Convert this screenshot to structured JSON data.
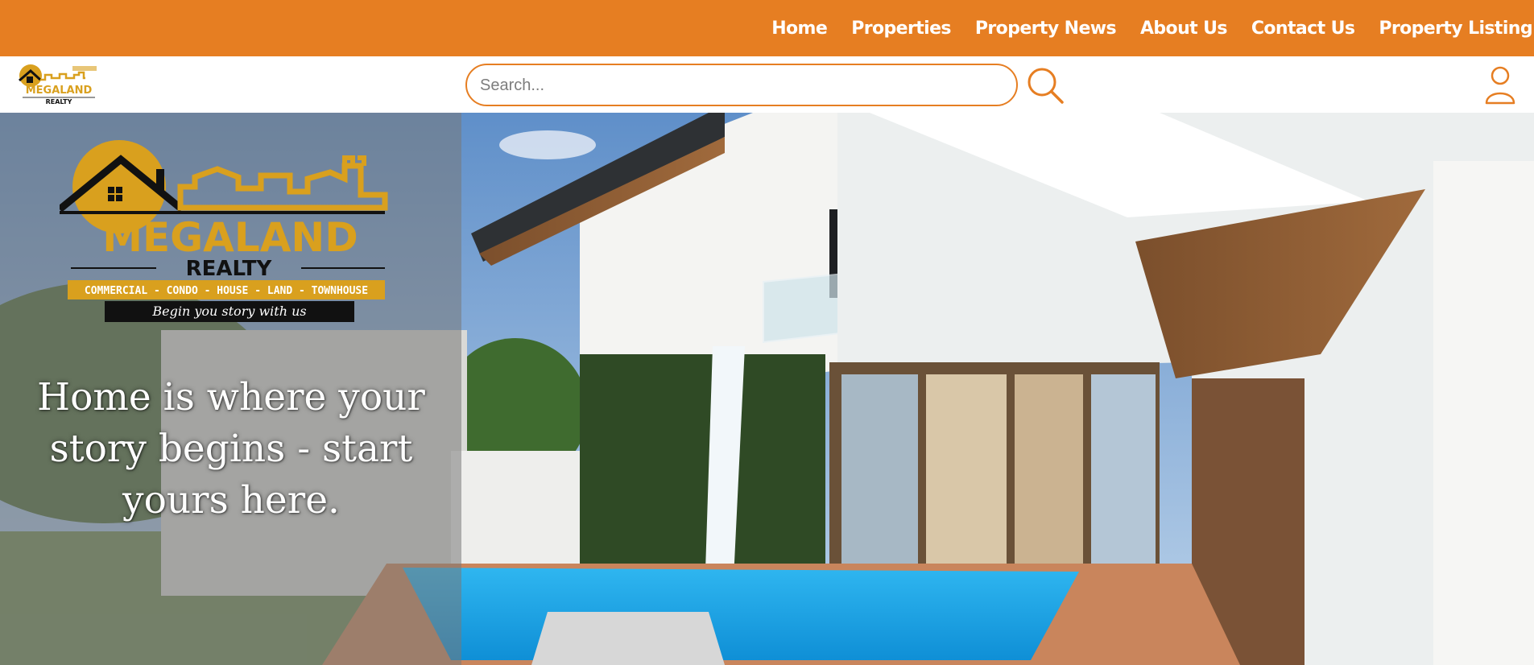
{
  "nav": {
    "items": [
      {
        "label": "Home"
      },
      {
        "label": "Properties"
      },
      {
        "label": "Property News"
      },
      {
        "label": "About Us"
      },
      {
        "label": "Contact Us"
      },
      {
        "label": "Property Listing"
      }
    ]
  },
  "header": {
    "search_placeholder": "Search...",
    "search_value": "",
    "search_icon": "search-icon",
    "account_icon": "user-icon"
  },
  "brand": {
    "name": "MEGALAND",
    "sub": "REALTY",
    "categories": "COMMERCIAL - CONDO - HOUSE - LAND - TOWNHOUSE",
    "slogan": "Begin you story with us"
  },
  "hero": {
    "tagline_lines": [
      "Home is where your",
      "story begins - start",
      "yours here."
    ]
  },
  "colors": {
    "accent": "#E67E22",
    "logo_gold": "#D9A01E",
    "overlay": "rgba(120,120,120,0.55)"
  }
}
